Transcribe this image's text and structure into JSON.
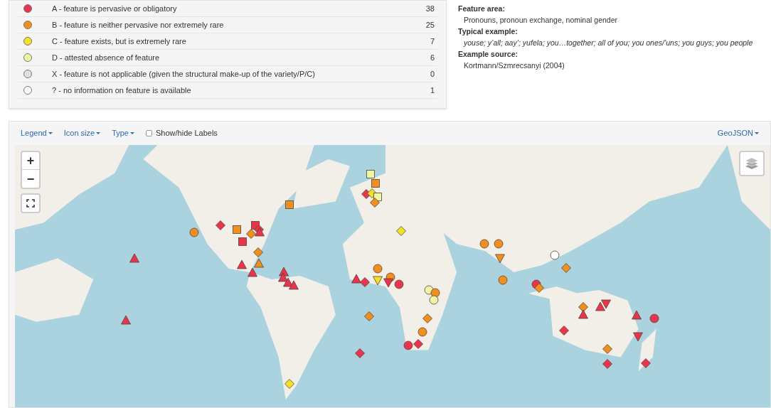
{
  "legend": [
    {
      "label": "A - feature is pervasive or obligatory",
      "count": "38",
      "color": "#e8344e"
    },
    {
      "label": "B - feature is neither pervasive nor extremely rare",
      "count": "25",
      "color": "#ef8f1f"
    },
    {
      "label": "C - feature exists, but is extremely rare",
      "count": "7",
      "color": "#f2e12a"
    },
    {
      "label": "D - attested absence of feature",
      "count": "6",
      "color": "#eff5a6"
    },
    {
      "label": "X - feature is not applicable (given the structural make-up of the variety/P/C)",
      "count": "0",
      "color": "#e0e0e0"
    },
    {
      "label": "? - no information on feature is available",
      "count": "1",
      "color": "#ffffff"
    }
  ],
  "info": [
    {
      "heading": "Feature area:",
      "text": "Pronouns, pronoun exchange, nominal gender",
      "italic": false
    },
    {
      "heading": "Typical example:",
      "text": "youse; y’all; aay’; yufela; you…together; all of you; you ones/’uns; you guys; you people",
      "italic": true
    },
    {
      "heading": "Example source:",
      "text": "Kortmann/Szmrecsanyi (2004)",
      "italic": false
    }
  ],
  "toolbar": {
    "menus": [
      "Legend",
      "Icon size",
      "Type"
    ],
    "labels_toggle": {
      "label": "Show/hide Labels",
      "checked": false
    },
    "export_menu": "GeoJSON"
  },
  "map": {
    "zoom_in": "+",
    "zoom_out": "−"
  }
}
